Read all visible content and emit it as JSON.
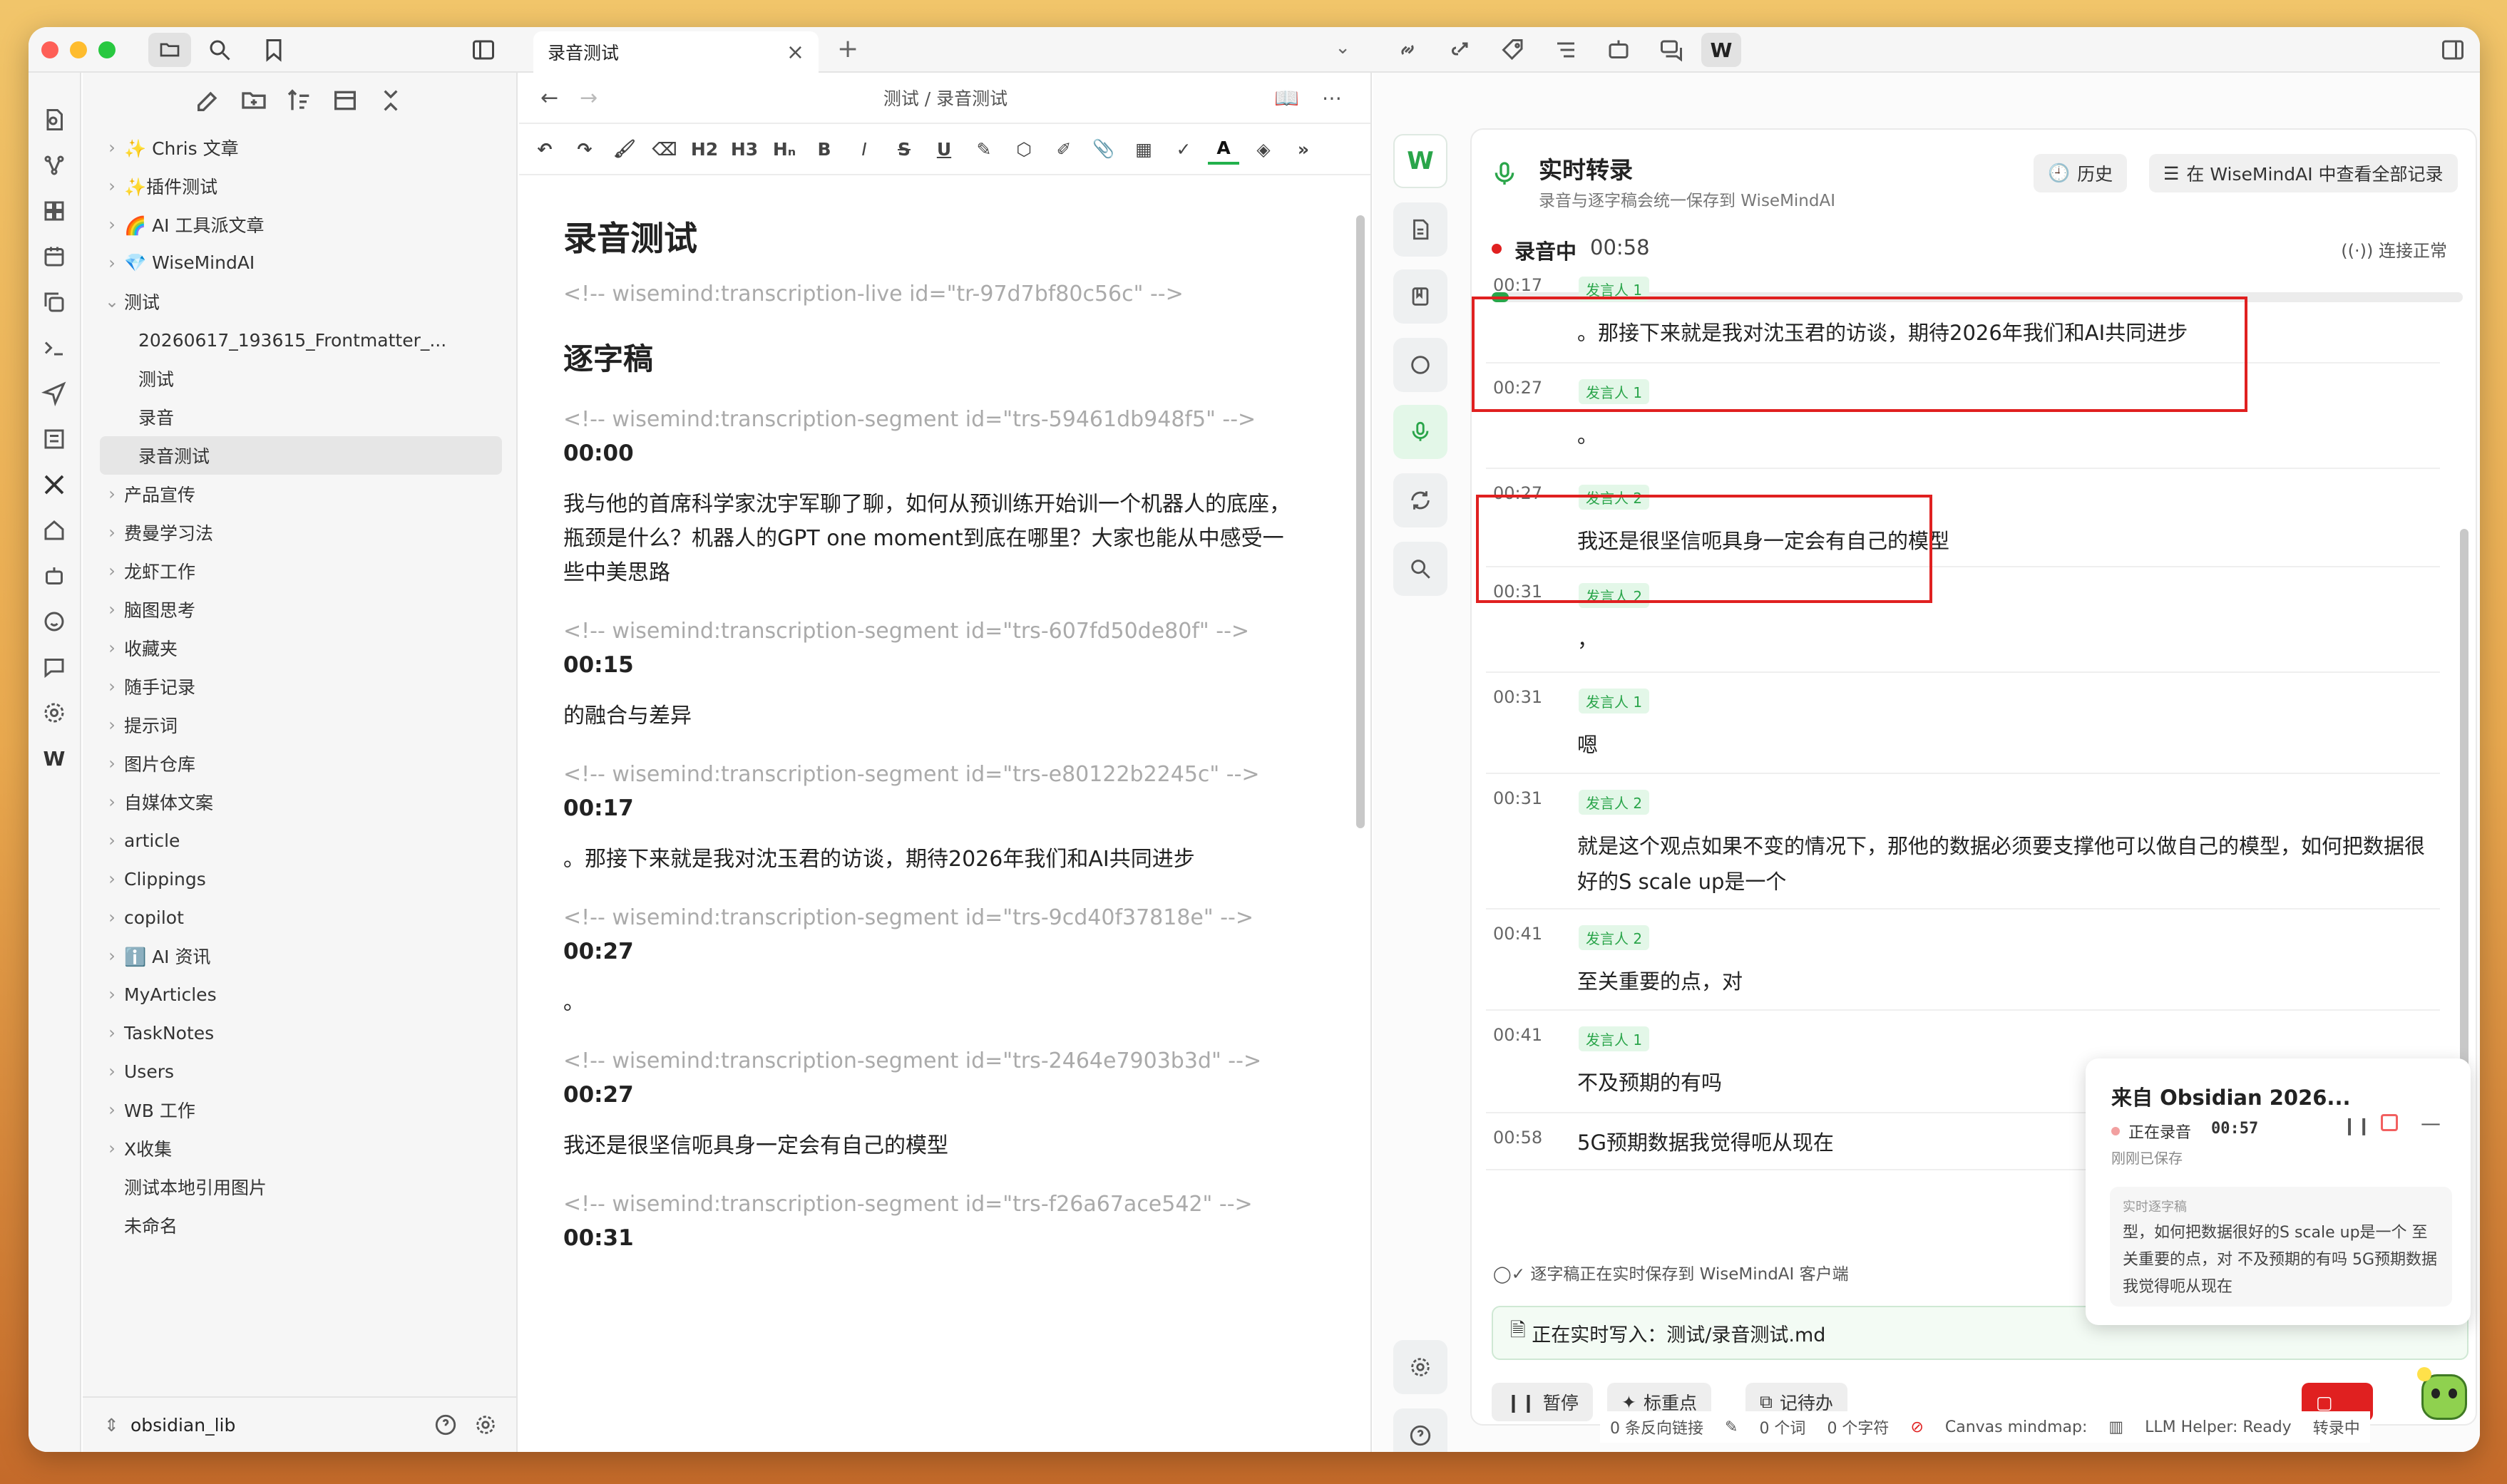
{
  "tabs": {
    "editor_tab": "录音测试"
  },
  "sidebar": {
    "items": [
      {
        "label": "✨ Chris 文章",
        "folder": true
      },
      {
        "label": "✨插件测试",
        "folder": true
      },
      {
        "label": "🌈 AI 工具派文章",
        "folder": true
      },
      {
        "label": "💎 WiseMindAI",
        "folder": true
      },
      {
        "label": "测试",
        "folder": true,
        "open": true
      },
      {
        "label": "20260617_193615_Frontmatter_...",
        "child": true
      },
      {
        "label": "测试",
        "child": true
      },
      {
        "label": "录音",
        "child": true
      },
      {
        "label": "录音测试",
        "child": true,
        "active": true
      },
      {
        "label": "产品宣传",
        "folder": true
      },
      {
        "label": "费曼学习法",
        "folder": true
      },
      {
        "label": "龙虾工作",
        "folder": true
      },
      {
        "label": "脑图思考",
        "folder": true
      },
      {
        "label": "收藏夹",
        "folder": true
      },
      {
        "label": "随手记录",
        "folder": true
      },
      {
        "label": "提示词",
        "folder": true
      },
      {
        "label": "图片仓库",
        "folder": true
      },
      {
        "label": "自媒体文案",
        "folder": true
      },
      {
        "label": "article",
        "folder": true
      },
      {
        "label": "Clippings",
        "folder": true
      },
      {
        "label": "copilot",
        "folder": true
      },
      {
        "label": "ℹ️ AI 资讯",
        "folder": true
      },
      {
        "label": "MyArticles",
        "folder": true
      },
      {
        "label": "TaskNotes",
        "folder": true
      },
      {
        "label": "Users",
        "folder": true
      },
      {
        "label": "WB 工作",
        "folder": true
      },
      {
        "label": "X收集",
        "folder": true
      },
      {
        "label": "测试本地引用图片",
        "folder": false
      },
      {
        "label": "未命名",
        "folder": false
      }
    ],
    "vault": "obsidian_lib"
  },
  "editor": {
    "breadcrumb": "测试 / 录音测试",
    "toolbar": [
      "H2",
      "H3",
      "Hₙ",
      "B",
      "I"
    ],
    "title": "录音测试",
    "live_comment": "<!-- wisemind:transcription-live id=\"tr-97d7bf80c56c\" -->",
    "heading": "逐字稿",
    "segments": [
      {
        "comment": "<!-- wisemind:transcription-segment id=\"trs-59461db948f5\" -->",
        "time": "00:00",
        "text": "我与他的首席科学家沈宇军聊了聊，如何从预训练开始训一个机器人的底座，瓶颈是什么？机器人的GPT one moment到底在哪里？大家也能从中感受一些中美思路"
      },
      {
        "comment": "<!-- wisemind:transcription-segment id=\"trs-607fd50de80f\" -->",
        "time": "00:15",
        "text": "的融合与差异"
      },
      {
        "comment": "<!-- wisemind:transcription-segment id=\"trs-e80122b2245c\" -->",
        "time": "00:17",
        "text": "。那接下来就是我对沈玉君的访谈，期待2026年我们和AI共同进步"
      },
      {
        "comment": "<!-- wisemind:transcription-segment id=\"trs-9cd40f37818e\" -->",
        "time": "00:27",
        "text": "。"
      },
      {
        "comment": "<!-- wisemind:transcription-segment id=\"trs-2464e7903b3d\" -->",
        "time": "00:27",
        "text": "我还是很坚信呃具身一定会有自己的模型"
      },
      {
        "comment": "<!-- wisemind:transcription-segment id=\"trs-f26a67ace542\" -->",
        "time": "00:31",
        "text": ""
      }
    ]
  },
  "panel": {
    "title": "实时转录",
    "subtitle": "录音与逐字稿会统一保存到 WiseMindAI",
    "history_btn": "历史",
    "view_all_btn": "在 WiseMindAI 中查看全部记录",
    "rec_label": "录音中",
    "rec_time": "00:58",
    "conn": "连接正常",
    "progress": 0.006,
    "segments": [
      {
        "time": "00:17",
        "speaker": "发言人 1",
        "text": "。那接下来就是我对沈玉君的访谈，期待2026年我们和AI共同进步"
      },
      {
        "time": "00:27",
        "speaker": "发言人 1",
        "text": "。"
      },
      {
        "time": "00:27",
        "speaker": "发言人 2",
        "text": "我还是很坚信呃具身一定会有自己的模型"
      },
      {
        "time": "00:31",
        "speaker": "发言人 2",
        "text": "，"
      },
      {
        "time": "00:31",
        "speaker": "发言人 1",
        "text": "嗯"
      },
      {
        "time": "00:31",
        "speaker": "发言人 2",
        "text": "就是这个观点如果不变的情况下，那他的数据必须要支撑他可以做自己的模型，如何把数据很好的S scale up是一个"
      },
      {
        "time": "00:41",
        "speaker": "发言人 2",
        "text": "至关重要的点，对"
      },
      {
        "time": "00:41",
        "speaker": "发言人 1",
        "text": "不及预期的有吗"
      },
      {
        "time": "00:58",
        "speaker": "",
        "text": "5G预期数据我觉得呃从现在"
      }
    ],
    "saving_note": "逐字稿正在实时保存到 WiseMindAI 客户端",
    "writing": "正在实时写入：测试/录音测试.md",
    "btn_pause": "暂停",
    "btn_mark": "标重点",
    "btn_todo": "记待办"
  },
  "floating": {
    "title": "来自 Obsidian 2026...",
    "status": "正在录音",
    "time": "00:57",
    "saved": "刚刚已保存",
    "label": "实时逐字稿",
    "text": "型，如何把数据很好的S scale up是一个 至关重要的点，对 不及预期的有吗 5G预期数据我觉得呃从现在"
  },
  "statusbar": {
    "backlinks": "0 条反向链接",
    "words": "0 个词",
    "chars": "0 个字符",
    "canvas": "Canvas mindmap:",
    "llm": "LLM Helper: Ready",
    "rec": "转录中"
  },
  "colors": {
    "accent_green": "#2aa54a",
    "record_red": "#e02020",
    "highlight": "#e02020"
  }
}
